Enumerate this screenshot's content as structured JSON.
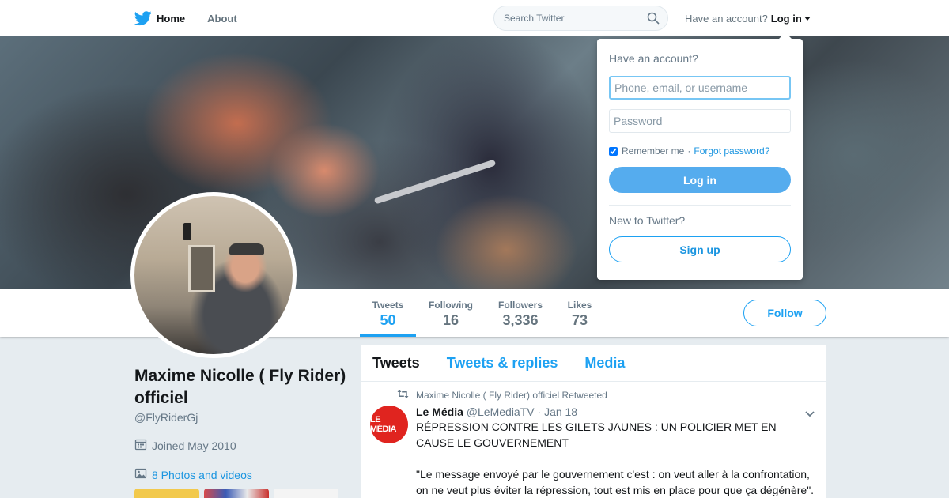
{
  "nav": {
    "home_label": "Home",
    "about_label": "About",
    "search_placeholder": "Search Twitter",
    "have_account_label": "Have an account?",
    "login_label": "Log in"
  },
  "icons": {
    "logo": "twitter-bird-icon",
    "search": "search-icon",
    "caret": "caret-down-icon",
    "calendar": "calendar-icon",
    "photos": "photo-icon",
    "retweet": "retweet-icon",
    "tweet_menu": "chevron-down-icon"
  },
  "colors": {
    "accent": "#1da1f2",
    "login_button": "#55acee",
    "link": "#1b95e0",
    "le_media_red": "#e0241f"
  },
  "profile": {
    "name": "Maxime Nicolle ( Fly Rider) officiel",
    "handle": "@FlyRiderGj",
    "joined": "Joined May 2010",
    "photos_videos": "8 Photos and videos"
  },
  "stats": [
    {
      "label": "Tweets",
      "value": "50",
      "active": true
    },
    {
      "label": "Following",
      "value": "16",
      "active": false
    },
    {
      "label": "Followers",
      "value": "3,336",
      "active": false
    },
    {
      "label": "Likes",
      "value": "73",
      "active": false
    }
  ],
  "follow_label": "Follow",
  "timeline": {
    "tabs": [
      "Tweets",
      "Tweets & replies",
      "Media"
    ],
    "active_tab": "Tweets",
    "tweets": [
      {
        "retweet_line": "Maxime Nicolle ( Fly Rider) officiel Retweeted",
        "author_name": "Le Média",
        "author_handle": "@LeMediaTV",
        "dot": "·",
        "date": "Jan 18",
        "avatar_text": "LE MÉDIA",
        "text": "RÉPRESSION CONTRE LES GILETS JAUNES : UN POLICIER MET EN CAUSE LE GOUVERNEMENT\n\n\"Le message envoyé par le gouvernement c'est : on veut aller à la confrontation, on ne veut plus éviter la répression, tout est mis en place pour que ça dégénère\"."
      }
    ]
  },
  "login_dropdown": {
    "title": "Have an account?",
    "username_placeholder": "Phone, email, or username",
    "password_placeholder": "Password",
    "remember_label": "Remember me",
    "separator": "·",
    "forgot_label": "Forgot password?",
    "remember_checked": true,
    "login_button": "Log in",
    "new_to_label": "New to Twitter?",
    "signup_button": "Sign up"
  }
}
